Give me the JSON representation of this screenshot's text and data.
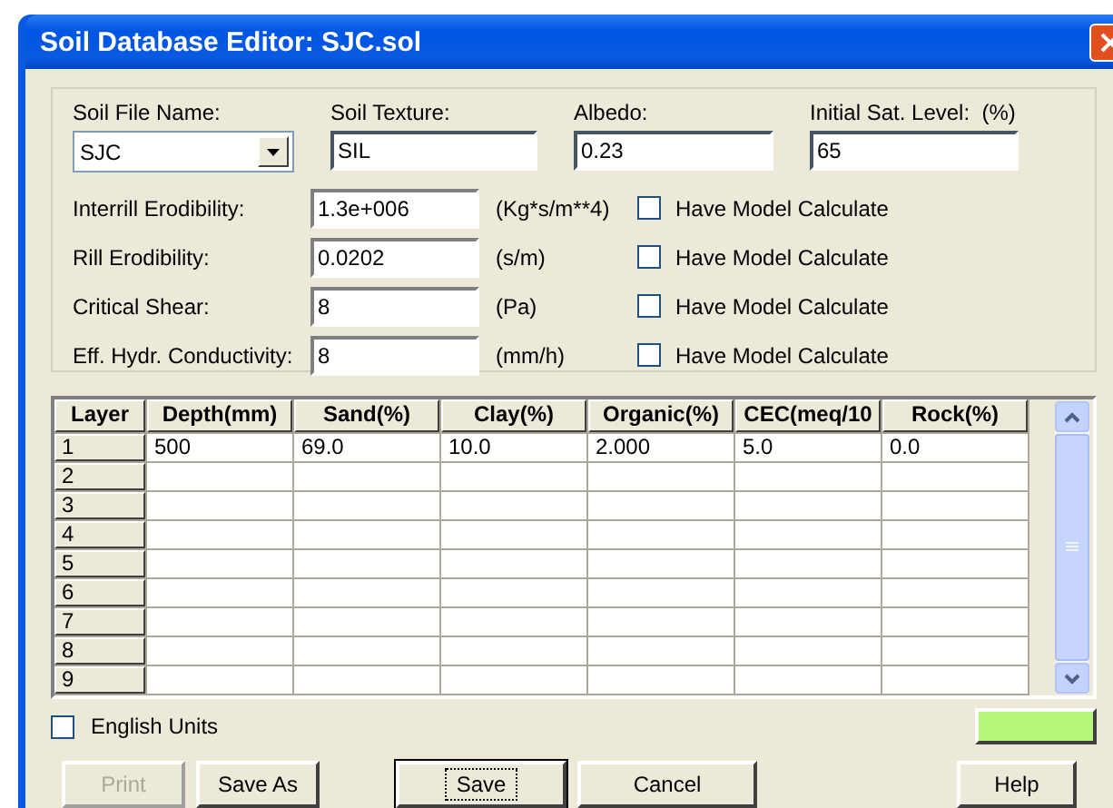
{
  "window": {
    "title": "Soil Database Editor: SJC.sol"
  },
  "header_fields": [
    {
      "label": "Soil File Name:",
      "value": "SJC",
      "kind": "dropdown"
    },
    {
      "label": "Soil Texture:",
      "value": "SIL",
      "kind": "text"
    },
    {
      "label": "Albedo:",
      "value": "0.23",
      "kind": "text"
    },
    {
      "label": "Initial Sat. Level:  (%)",
      "value": "65",
      "kind": "text"
    }
  ],
  "parameters": [
    {
      "label": "Interrill Erodibility:",
      "value": "1.3e+006",
      "unit": "(Kg*s/m**4)",
      "calculate_label": "Have Model Calculate",
      "checked": false
    },
    {
      "label": "Rill Erodibility:",
      "value": "0.0202",
      "unit": "(s/m)",
      "calculate_label": "Have Model Calculate",
      "checked": false
    },
    {
      "label": "Critical Shear:",
      "value": "8",
      "unit": "(Pa)",
      "calculate_label": "Have Model Calculate",
      "checked": false
    },
    {
      "label": "Eff. Hydr. Conductivity:",
      "value": "8",
      "unit": "(mm/h)",
      "calculate_label": "Have Model Calculate",
      "checked": false
    }
  ],
  "layers_table": {
    "columns": [
      "Layer",
      "Depth(mm)",
      "Sand(%)",
      "Clay(%)",
      "Organic(%)",
      "CEC(meq/10",
      "Rock(%)"
    ],
    "rows": [
      {
        "layer": "1",
        "cells": [
          "500",
          "69.0",
          "10.0",
          "2.000",
          "5.0",
          "0.0"
        ]
      },
      {
        "layer": "2"
      },
      {
        "layer": "3"
      },
      {
        "layer": "4"
      },
      {
        "layer": "5"
      },
      {
        "layer": "6"
      },
      {
        "layer": "7"
      },
      {
        "layer": "8"
      },
      {
        "layer": "9"
      }
    ]
  },
  "english_units": {
    "label": "English Units",
    "checked": false
  },
  "status_indicator": {
    "color": "#b5f77b"
  },
  "buttons": [
    {
      "label": "Print",
      "disabled": true,
      "focused": false
    },
    {
      "label": "Save As",
      "disabled": false,
      "focused": false
    },
    {
      "label": "Save",
      "disabled": false,
      "focused": true
    },
    {
      "label": "Cancel",
      "disabled": false,
      "focused": false
    },
    {
      "label": "Help",
      "disabled": false,
      "focused": false
    }
  ]
}
